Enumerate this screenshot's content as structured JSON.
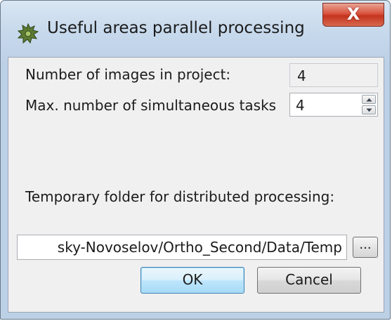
{
  "window": {
    "title": "Useful areas parallel processing",
    "close_label": "X"
  },
  "fields": {
    "images_label": "Number of images in project:",
    "images_value": "4",
    "tasks_label": "Max. number of simultaneous tasks",
    "tasks_value": "4",
    "temp_folder_label": "Temporary folder for distributed processing:",
    "temp_folder_value": "sky-Novoselov/Ortho_Second/Data/Temp",
    "browse_label": "..."
  },
  "buttons": {
    "ok_label": "OK",
    "cancel_label": "Cancel"
  },
  "icons": {
    "app": "puzzle-gear-icon",
    "close": "close-icon",
    "spin_up": "chevron-up-icon",
    "spin_down": "chevron-down-icon"
  },
  "colors": {
    "close_button": "#d9543e",
    "ok_border": "#3c7fb1"
  }
}
